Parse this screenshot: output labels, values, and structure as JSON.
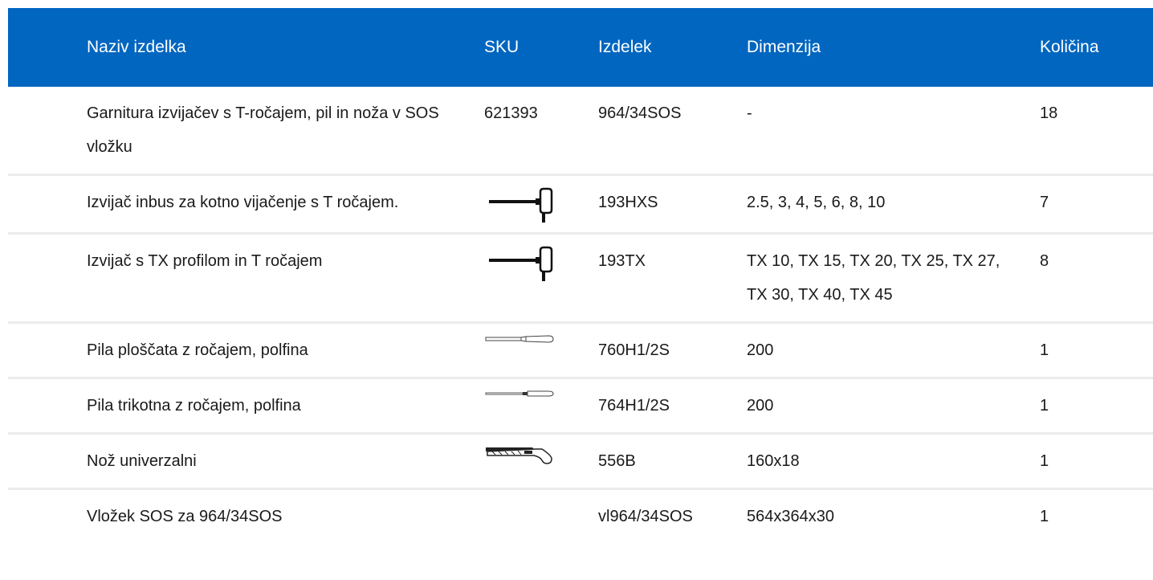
{
  "table": {
    "headers": [
      "Naziv izdelka",
      "SKU",
      "Izdelek",
      "Dimenzija",
      "Količina"
    ],
    "rows": [
      {
        "name": "Garnitura izvijačev s T-ročajem, pil in noža v SOS vložku",
        "sku": "621393",
        "sku_icon": "",
        "product": "964/34SOS",
        "dimension": "-",
        "quantity": "18"
      },
      {
        "name": "Izvijač inbus za kotno vijačenje s T ročajem.",
        "sku": "",
        "sku_icon": "t-handle-hex-screwdriver-icon",
        "product": "193HXS",
        "dimension": "2.5, 3, 4, 5, 6, 8, 10",
        "quantity": "7"
      },
      {
        "name": "Izvijač s TX profilom in T ročajem",
        "sku": "",
        "sku_icon": "t-handle-torx-screwdriver-icon",
        "product": "193TX",
        "dimension": "TX 10, TX 15, TX 20, TX 25, TX 27, TX 30, TX 40, TX 45",
        "quantity": "8"
      },
      {
        "name": "Pila ploščata z ročajem, polfina",
        "sku": "",
        "sku_icon": "flat-file-icon",
        "product": "760H1/2S",
        "dimension": "200",
        "quantity": "1"
      },
      {
        "name": "Pila trikotna z ročajem, polfina",
        "sku": "",
        "sku_icon": "triangular-file-icon",
        "product": "764H1/2S",
        "dimension": "200",
        "quantity": "1"
      },
      {
        "name": "Nož univerzalni",
        "sku": "",
        "sku_icon": "utility-knife-icon",
        "product": "556B",
        "dimension": "160x18",
        "quantity": "1"
      },
      {
        "name": "Vložek SOS za 964/34SOS",
        "sku": "",
        "sku_icon": "",
        "product": "vl964/34SOS",
        "dimension": "564x364x30",
        "quantity": "1"
      }
    ]
  },
  "colors": {
    "header_bg": "#0066c0",
    "header_text": "#ffffff",
    "row_divider": "#ececec"
  }
}
